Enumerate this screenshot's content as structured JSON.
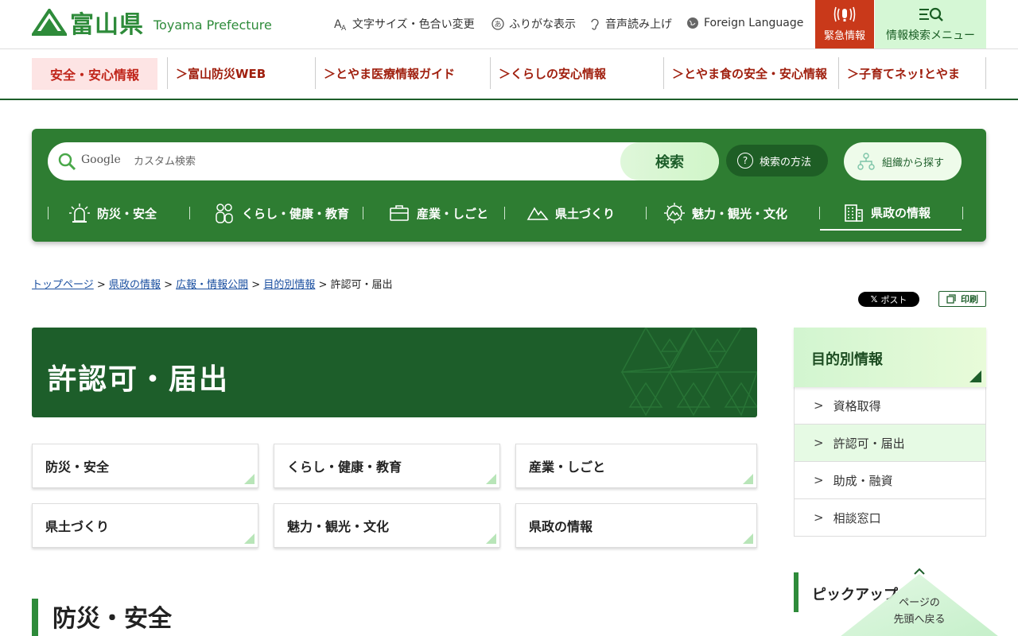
{
  "header": {
    "logo_jp": "富山県",
    "logo_en": "Toyama Prefecture",
    "util": [
      {
        "label": "文字サイズ・色合い変更",
        "icon": "text-size-icon"
      },
      {
        "label": "ふりがな表示",
        "icon": "furigana-icon"
      },
      {
        "label": "音声読み上げ",
        "icon": "ear-icon"
      },
      {
        "label": "Foreign Language",
        "icon": "globe-icon"
      }
    ],
    "emergency": "緊急情報",
    "search_menu": "情報検索メニュー"
  },
  "subnav": {
    "active": "安全・安心情報",
    "items": [
      "富山防災WEB",
      "とやま医療情報ガイド",
      "くらしの安心情報",
      "とやま食の安全・安心情報",
      "子育てネッ!とやま"
    ]
  },
  "search": {
    "brand": "Google",
    "placeholder": "カスタム検索",
    "button": "検索",
    "how": "検索の方法",
    "org": "組織から探す"
  },
  "categories": [
    "防災・安全",
    "くらし・健康・教育",
    "産業・しごと",
    "県土づくり",
    "魅力・観光・文化",
    "県政の情報"
  ],
  "breadcrumb": {
    "links": [
      "トップページ",
      "県政の情報",
      "広報・情報公開",
      "目的別情報"
    ],
    "current": "許認可・届出",
    "sep": ">"
  },
  "share": {
    "x_post": "ポスト",
    "print": "印刷"
  },
  "page": {
    "title": "許認可・届出"
  },
  "cards": [
    "防災・安全",
    "くらし・健康・教育",
    "産業・しごと",
    "県土づくり",
    "魅力・観光・文化",
    "県政の情報"
  ],
  "section": {
    "heading": "防災・安全"
  },
  "sidebar": {
    "title": "目的別情報",
    "items": [
      "資格取得",
      "許認可・届出",
      "助成・融資",
      "相談窓口"
    ],
    "current_index": 1,
    "pickup": "ピックアップ"
  },
  "totop": {
    "line1": "ページの",
    "line2": "先頭へ戻る"
  },
  "colors": {
    "brand_green": "#2e7d32",
    "dark_green": "#1d5e2a",
    "emergency_red": "#c9391a",
    "accent_red": "#a0200f"
  }
}
